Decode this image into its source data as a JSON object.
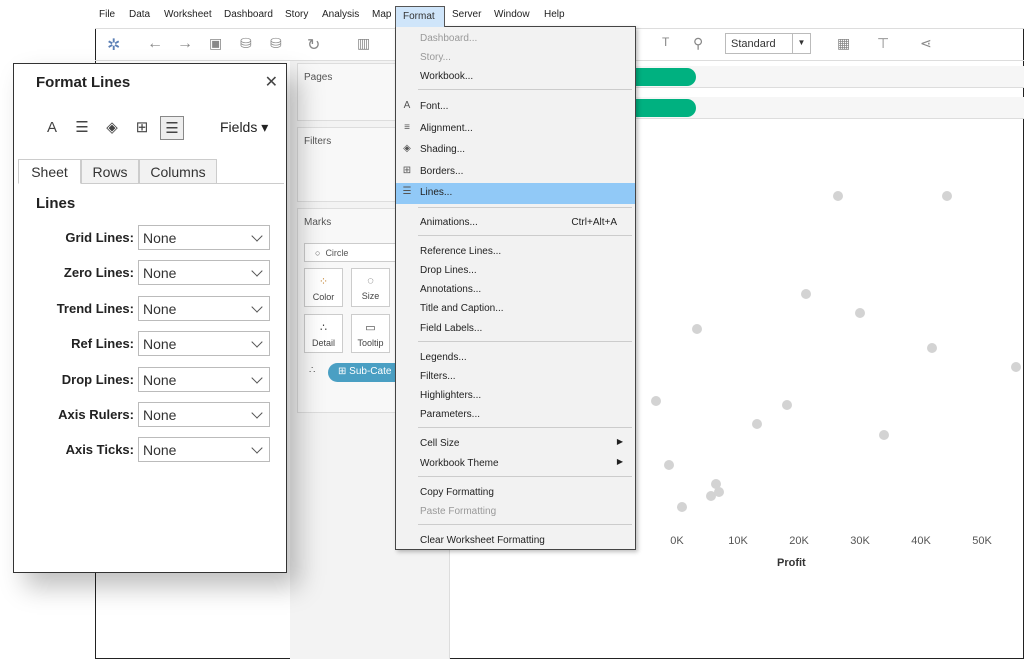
{
  "menubar": {
    "items": [
      "File",
      "Data",
      "Worksheet",
      "Dashboard",
      "Story",
      "Analysis",
      "Map",
      "Format",
      "Server",
      "Window",
      "Help"
    ]
  },
  "toolbar": {
    "fit_select": "Standard"
  },
  "sidebar": {
    "pages": "Pages",
    "filters": "Filters",
    "marks": "Marks",
    "mark_type": "Circle",
    "color": "Color",
    "size": "Size",
    "detail": "Detail",
    "tooltip": "Tooltip",
    "pill": "Sub-Cate"
  },
  "format_menu": {
    "items": [
      {
        "label": "Dashboard...",
        "disabled": true
      },
      {
        "label": "Story...",
        "disabled": true
      },
      {
        "label": "Workbook..."
      },
      {
        "label": "Font...",
        "icon": "A"
      },
      {
        "label": "Alignment...",
        "icon": "≡"
      },
      {
        "label": "Shading...",
        "icon": "◈"
      },
      {
        "label": "Borders...",
        "icon": "⊞"
      },
      {
        "label": "Lines...",
        "icon": "☰",
        "highlighted": true
      },
      {
        "label": "Animations...",
        "shortcut": "Ctrl+Alt+A"
      },
      {
        "label": "Reference Lines..."
      },
      {
        "label": "Drop Lines..."
      },
      {
        "label": "Annotations..."
      },
      {
        "label": "Title and Caption..."
      },
      {
        "label": "Field Labels..."
      },
      {
        "label": "Legends..."
      },
      {
        "label": "Filters..."
      },
      {
        "label": "Highlighters..."
      },
      {
        "label": "Parameters..."
      },
      {
        "label": "Cell Size",
        "submenu": true
      },
      {
        "label": "Workbook Theme",
        "submenu": true
      },
      {
        "label": "Copy Formatting"
      },
      {
        "label": "Paste Formatting",
        "disabled": true
      },
      {
        "label": "Clear Worksheet Formatting"
      }
    ]
  },
  "dialog": {
    "title": "Format Lines",
    "fields": "Fields",
    "tabs": [
      "Sheet",
      "Rows",
      "Columns"
    ],
    "active_tab": "Sheet",
    "section": "Lines",
    "rows": [
      {
        "label": "Grid Lines:",
        "value": "None"
      },
      {
        "label": "Zero Lines:",
        "value": "None"
      },
      {
        "label": "Trend Lines:",
        "value": "None"
      },
      {
        "label": "Ref Lines:",
        "value": "None"
      },
      {
        "label": "Drop Lines:",
        "value": "None"
      },
      {
        "label": "Axis Rulers:",
        "value": "None"
      },
      {
        "label": "Axis Ticks:",
        "value": "None"
      }
    ]
  },
  "colors": {
    "accent_pill": "#00b180",
    "menu_highlight": "#91c9f7",
    "marks": "#d3d3d3",
    "field_pill": "#4a9fc3"
  },
  "chart_data": {
    "type": "scatter",
    "xlabel": "Profit",
    "ylabel": "",
    "x_ticks": [
      "0K",
      "10K",
      "20K",
      "30K",
      "40K",
      "50K"
    ],
    "xlim": [
      -5,
      57
    ],
    "points": [
      {
        "x": 26.4,
        "y": 88
      },
      {
        "x": 44.3,
        "y": 88
      },
      {
        "x": 21.1,
        "y": 62
      },
      {
        "x": 30.0,
        "y": 57
      },
      {
        "x": 3.3,
        "y": 53
      },
      {
        "x": 41.8,
        "y": 48
      },
      {
        "x": 55.6,
        "y": 43
      },
      {
        "x": -3.4,
        "y": 34
      },
      {
        "x": 18.0,
        "y": 33
      },
      {
        "x": 13.1,
        "y": 28
      },
      {
        "x": 33.9,
        "y": 25
      },
      {
        "x": -1.3,
        "y": 17
      },
      {
        "x": 6.4,
        "y": 12
      },
      {
        "x": 5.6,
        "y": 9
      },
      {
        "x": 6.9,
        "y": 10
      },
      {
        "x": 0.8,
        "y": 6
      }
    ]
  }
}
